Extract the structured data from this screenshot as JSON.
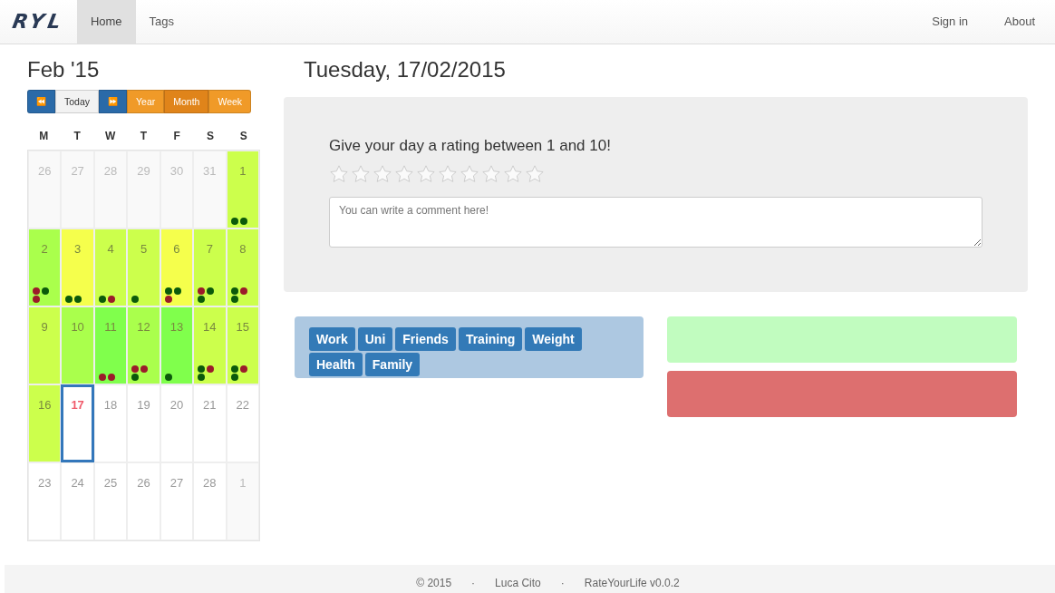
{
  "navbar": {
    "brand": "RYL",
    "tabs": [
      {
        "label": "Home",
        "selected": true
      },
      {
        "label": "Tags",
        "selected": false
      }
    ],
    "right_links": [
      "Sign in",
      "About"
    ]
  },
  "calendar": {
    "title": "Feb '15",
    "nav_buttons": [
      {
        "kind": "prev",
        "label": "⏪"
      },
      {
        "kind": "today",
        "label": "Today"
      },
      {
        "kind": "next",
        "label": "⏩"
      }
    ],
    "views": [
      {
        "label": "Year",
        "selected": false
      },
      {
        "label": "Month",
        "selected": true
      },
      {
        "label": "Week",
        "selected": false
      }
    ],
    "weekdays": [
      "M",
      "T",
      "W",
      "T",
      "F",
      "S",
      "S"
    ],
    "days": [
      {
        "day": "26",
        "outside": true,
        "today": false
      },
      {
        "day": "27",
        "outside": true,
        "today": false
      },
      {
        "day": "28",
        "outside": true,
        "today": false
      },
      {
        "day": "29",
        "outside": true,
        "today": false
      },
      {
        "day": "30",
        "outside": true,
        "today": false
      },
      {
        "day": "31",
        "outside": true,
        "today": false
      },
      {
        "day": "1",
        "outside": false,
        "today": false,
        "color": "#ccff4c",
        "dots": [
          {
            "color": "#0b5a0b"
          },
          {
            "color": "#0b5a0b"
          }
        ]
      },
      {
        "day": "2",
        "outside": false,
        "today": false,
        "color": "#aaff4c",
        "dots": [
          {
            "color": "#9b1b2a"
          },
          {
            "color": "#0b5a0b"
          },
          {
            "color": "#9b1b2a"
          }
        ]
      },
      {
        "day": "3",
        "outside": false,
        "today": false,
        "color": "#f5ff4c",
        "dots": [
          {
            "color": "#0b5a0b"
          },
          {
            "color": "#0b5a0b"
          }
        ]
      },
      {
        "day": "4",
        "outside": false,
        "today": false,
        "color": "#ccff4c",
        "dots": [
          {
            "color": "#0b5a0b"
          },
          {
            "color": "#9b1b2a"
          }
        ]
      },
      {
        "day": "5",
        "outside": false,
        "today": false,
        "color": "#ccff4c",
        "dots": [
          {
            "color": "#0b5a0b"
          }
        ]
      },
      {
        "day": "6",
        "outside": false,
        "today": false,
        "color": "#f5ff4c",
        "dots": [
          {
            "color": "#0b5a0b"
          },
          {
            "color": "#0b5a0b"
          },
          {
            "color": "#9b1b2a"
          }
        ]
      },
      {
        "day": "7",
        "outside": false,
        "today": false,
        "color": "#ccff4c",
        "dots": [
          {
            "color": "#9b1b2a"
          },
          {
            "color": "#0b5a0b"
          },
          {
            "color": "#0b5a0b"
          }
        ]
      },
      {
        "day": "8",
        "outside": false,
        "today": false,
        "color": "#ccff4c",
        "dots": [
          {
            "color": "#0b5a0b"
          },
          {
            "color": "#9b1b2a"
          },
          {
            "color": "#0b5a0b"
          }
        ]
      },
      {
        "day": "9",
        "outside": false,
        "today": false,
        "color": "#ccff4c"
      },
      {
        "day": "10",
        "outside": false,
        "today": false,
        "color": "#aaff4c"
      },
      {
        "day": "11",
        "outside": false,
        "today": false,
        "color": "#80ff4c",
        "dots": [
          {
            "color": "#9b1b2a"
          },
          {
            "color": "#9b1b2a"
          }
        ]
      },
      {
        "day": "12",
        "outside": false,
        "today": false,
        "color": "#aaff4c",
        "dots": [
          {
            "color": "#9b1b2a"
          },
          {
            "color": "#9b1b2a"
          },
          {
            "color": "#0b5a0b"
          }
        ]
      },
      {
        "day": "13",
        "outside": false,
        "today": false,
        "color": "#80ff4c",
        "dots": [
          {
            "color": "#0b5a0b"
          }
        ]
      },
      {
        "day": "14",
        "outside": false,
        "today": false,
        "color": "#ccff4c",
        "dots": [
          {
            "color": "#0b5a0b"
          },
          {
            "color": "#9b1b2a"
          },
          {
            "color": "#0b5a0b"
          }
        ]
      },
      {
        "day": "15",
        "outside": false,
        "today": false,
        "color": "#ccff4c",
        "dots": [
          {
            "color": "#0b5a0b"
          },
          {
            "color": "#9b1b2a"
          },
          {
            "color": "#0b5a0b"
          }
        ]
      },
      {
        "day": "16",
        "outside": false,
        "today": false,
        "color": "#ccff4c"
      },
      {
        "day": "17",
        "outside": false,
        "today": true
      },
      {
        "day": "18",
        "outside": false,
        "today": false
      },
      {
        "day": "19",
        "outside": false,
        "today": false
      },
      {
        "day": "20",
        "outside": false,
        "today": false
      },
      {
        "day": "21",
        "outside": false,
        "today": false
      },
      {
        "day": "22",
        "outside": false,
        "today": false
      },
      {
        "day": "23",
        "outside": false,
        "today": false
      },
      {
        "day": "24",
        "outside": false,
        "today": false
      },
      {
        "day": "25",
        "outside": false,
        "today": false
      },
      {
        "day": "26",
        "outside": false,
        "today": false
      },
      {
        "day": "27",
        "outside": false,
        "today": false
      },
      {
        "day": "28",
        "outside": false,
        "today": false
      },
      {
        "day": "1",
        "outside": true,
        "today": false
      }
    ]
  },
  "date_title": "Tuesday, 17/02/2015",
  "rating": {
    "prompt": "Give your day a rating between 1 and 10!",
    "stars": 0,
    "comment": {
      "placeholder": "You can write a comment here!"
    }
  },
  "tags": [
    "Work",
    "Uni",
    "Friends",
    "Training",
    "Weight",
    "Health",
    "Family"
  ],
  "status_boxes": [
    {
      "color": "#c1fcbf"
    },
    {
      "color": "#dd6f6f"
    }
  ],
  "footer": [
    "© 2015",
    "·",
    "Luca Cito",
    "·",
    "RateYourLife v0.0.2"
  ]
}
